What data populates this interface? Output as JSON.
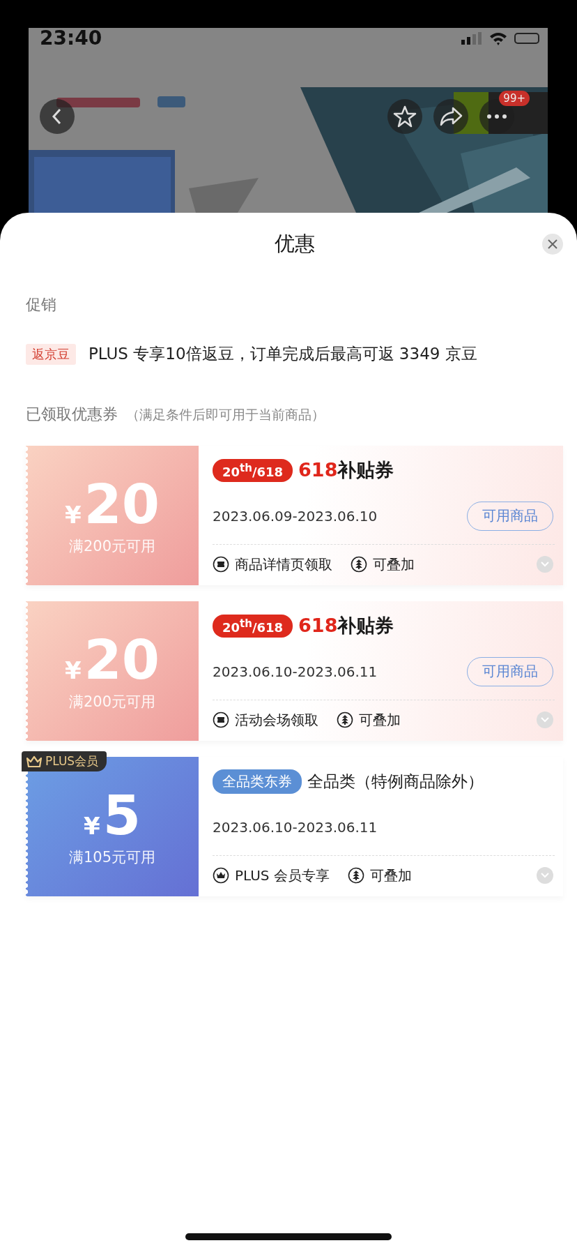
{
  "status_bar": {
    "time": "23:40"
  },
  "top_bar": {
    "badge": "99+"
  },
  "sheet": {
    "title": "优惠"
  },
  "promotions": {
    "heading": "促销",
    "items": [
      {
        "tag": "返京豆",
        "text": "PLUS 专享10倍返豆，订单完成后最高可返 3349 京豆"
      }
    ]
  },
  "coupons_section": {
    "heading": "已领取优惠券",
    "note": "（满足条件后即可用于当前商品）"
  },
  "coupons": [
    {
      "kind": "subsidy",
      "currency": "¥",
      "amount": "20",
      "condition": "满200元可用",
      "badge": "20$^{th}$/618",
      "title_accent": "618",
      "title": "补贴券",
      "dates": "2023.06.09-2023.06.10",
      "button": "可用商品",
      "features": [
        {
          "kind": "ticket",
          "text": "商品详情页领取"
        },
        {
          "kind": "stack",
          "text": "可叠加"
        }
      ]
    },
    {
      "kind": "subsidy",
      "currency": "¥",
      "amount": "20",
      "condition": "满200元可用",
      "badge": "20$^{th}$/618",
      "title_accent": "618",
      "title": "补贴券",
      "dates": "2023.06.10-2023.06.11",
      "button": "可用商品",
      "features": [
        {
          "kind": "ticket",
          "text": "活动会场领取"
        },
        {
          "kind": "stack",
          "text": "可叠加"
        }
      ]
    },
    {
      "kind": "plus",
      "corner_tag": "PLUS会员",
      "currency": "¥",
      "amount": "5",
      "condition": "满105元可用",
      "badge": "全品类东券",
      "title": "全品类（特例商品除外）",
      "dates": "2023.06.10-2023.06.11",
      "features": [
        {
          "kind": "crown",
          "text": "PLUS 会员专享"
        },
        {
          "kind": "stack",
          "text": "可叠加"
        }
      ]
    }
  ]
}
